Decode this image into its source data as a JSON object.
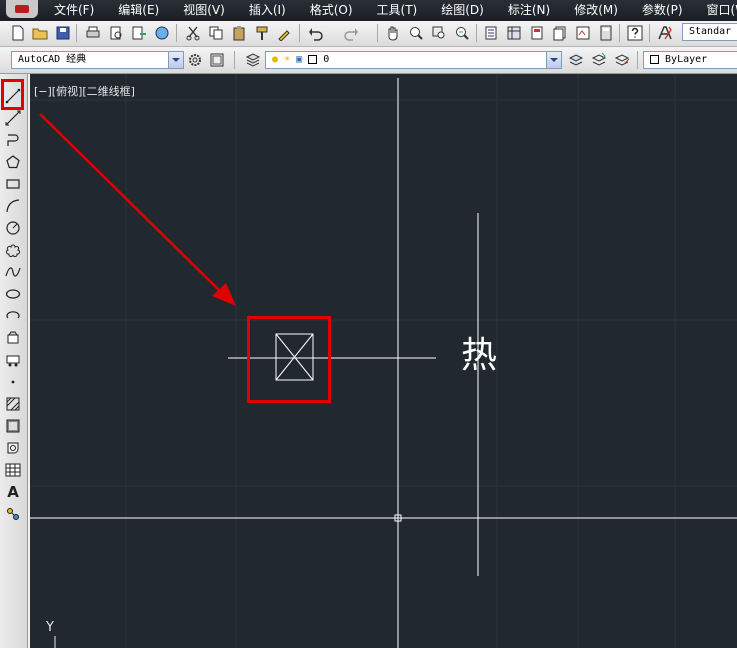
{
  "menu": {
    "items": [
      "文件(F)",
      "编辑(E)",
      "视图(V)",
      "插入(I)",
      "格式(O)",
      "工具(T)",
      "绘图(D)",
      "标注(N)",
      "修改(M)",
      "参数(P)",
      "窗口(W)"
    ]
  },
  "toolbar": {
    "text_style_value": "Standar",
    "workspace_value": "AutoCAD 经典",
    "layer_value": "0",
    "color_value": "ByLayer"
  },
  "drawing": {
    "viewport_label": "[−][俯视][二维线框]",
    "hot_text": "热",
    "ucs_y_label": "Y"
  },
  "left_toolbar": {
    "text_tool_label": "A"
  },
  "colors": {
    "canvas_background": "#212830",
    "annotation_red": "#e00000",
    "line_white": "#ffffff"
  }
}
